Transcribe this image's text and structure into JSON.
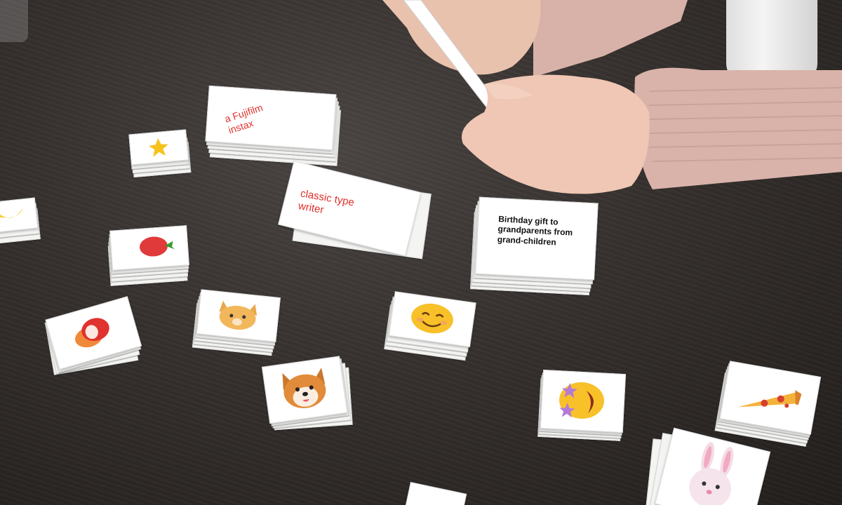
{
  "cards": {
    "instax": "a Fujifilm instax",
    "typewriter": "classic type writer",
    "prompt": "Birthday gift to grandparents from grand-children"
  },
  "icons": [
    "star-icon",
    "strawberry-icon",
    "lychee-icon",
    "cat-face-icon",
    "dog-face-icon",
    "smiling-face-icon",
    "star-struck-face-icon",
    "pizza-icon",
    "rabbit-face-icon",
    "banana-icon"
  ]
}
